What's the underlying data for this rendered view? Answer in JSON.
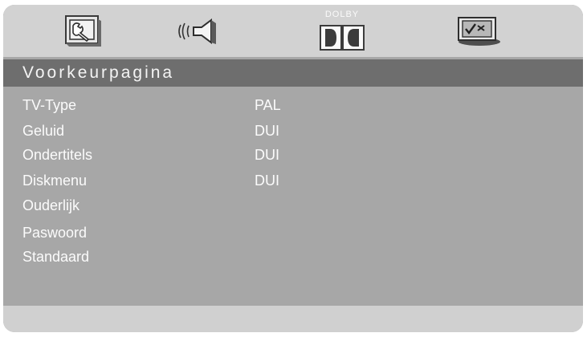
{
  "tabs": [
    {
      "name": "system-setup",
      "icon": "wrench-icon"
    },
    {
      "name": "audio-setup",
      "icon": "speaker-icon"
    },
    {
      "name": "dolby-setup",
      "icon": "dolby-logo-icon",
      "label": "DOLBY"
    },
    {
      "name": "preference-setup",
      "icon": "checkmark-monitor-icon"
    }
  ],
  "page": {
    "title": "Voorkeurpagina"
  },
  "menu": [
    {
      "label": "TV-Type",
      "value": "PAL"
    },
    {
      "label": "Geluid",
      "value": "DUI"
    },
    {
      "label": "Ondertitels",
      "value": "DUI"
    },
    {
      "label": "Diskmenu",
      "value": "DUI"
    },
    {
      "label": "Ouderlijk",
      "value": ""
    },
    {
      "label": "Paswoord",
      "value": ""
    },
    {
      "label": "Standaard",
      "value": ""
    }
  ],
  "colors": {
    "panel": "#a7a7a7",
    "icon_bar": "#d2d2d2",
    "title_bar": "#6e6e6e",
    "text": "#fbfbfb"
  }
}
